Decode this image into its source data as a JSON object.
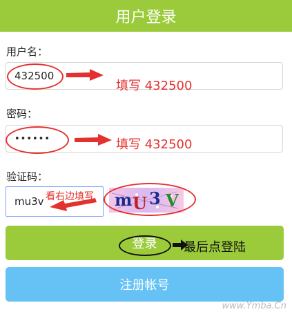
{
  "header": {
    "title": "用户登录"
  },
  "form": {
    "username_label": "用户名：",
    "username_value": "432500",
    "password_label": "密码：",
    "password_value": "••••••",
    "captcha_label": "验证码：",
    "captcha_value": "mu3v",
    "captcha_image_text": [
      "m",
      "U",
      "3",
      "V"
    ],
    "login_label": "登录",
    "register_label": "注册帐号"
  },
  "annotations": {
    "username_hint": "填写 432500",
    "password_hint": "填写 432500",
    "captcha_hint": "看右边填写",
    "login_hint": "最后点登陆"
  },
  "watermark": "www.Ymba.Cn",
  "colors": {
    "primary": "#9bcb3a",
    "secondary": "#66c2f5",
    "annotation": "#e4312f"
  }
}
